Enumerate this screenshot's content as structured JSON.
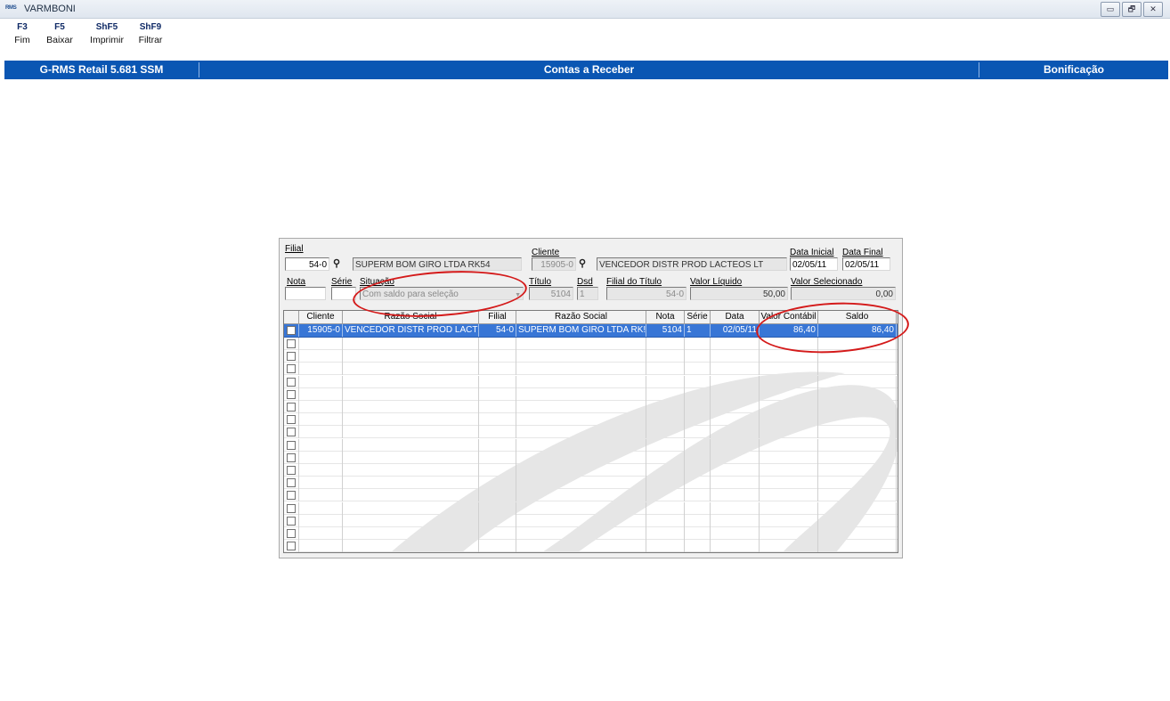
{
  "window": {
    "app_icon": "RMS",
    "title": "VARMBONI",
    "controls": [
      "▭",
      "🗗",
      "✕"
    ]
  },
  "fkeys": [
    {
      "key": "F3",
      "label": "Fim"
    },
    {
      "key": "F5",
      "label": "Baixar"
    },
    {
      "key": "ShF5",
      "label": "Imprimir"
    },
    {
      "key": "ShF9",
      "label": "Filtrar"
    }
  ],
  "bluebar": {
    "product": "G-RMS Retail 5.681 SSM",
    "module": "Contas a Receber",
    "screen": "Bonificação"
  },
  "form": {
    "filial_label": "Filial",
    "filial_value": "54-0",
    "filial_name": "SUPERM BOM GIRO LTDA RK54",
    "cliente_label": "Cliente",
    "cliente_value": "15905-0",
    "cliente_name": "VENCEDOR DISTR PROD LACTEOS LT",
    "data_inicial_label": "Data Inicial",
    "data_inicial_value": "02/05/11",
    "data_final_label": "Data Final",
    "data_final_value": "02/05/11",
    "nota_label": "Nota",
    "nota_value": "",
    "serie_label": "Série",
    "serie_value": "",
    "situacao_label": "Situação",
    "situacao_value": "Com saldo para seleção",
    "titulo_label": "Título",
    "titulo_value": "5104",
    "dsd_label": "Dsd",
    "dsd_value": "1",
    "filial_titulo_label": "Filial do Título",
    "filial_titulo_value": "54-0",
    "valor_liquido_label": "Valor Líquido",
    "valor_liquido_value": "50,00",
    "valor_selecionado_label": "Valor Selecionado",
    "valor_selecionado_value": "0,00"
  },
  "grid": {
    "headers": [
      "",
      "Cliente",
      "Razão Social",
      "Filial",
      "Razão Social",
      "Nota",
      "Série",
      "Data",
      "Valor Contábil",
      "Saldo"
    ],
    "rows": [
      [
        "",
        "15905-0",
        "VENCEDOR DISTR PROD LACT",
        "54-0",
        "SUPERM BOM GIRO LTDA RK!",
        "5104",
        "1",
        "02/05/11",
        "86,40",
        "86,40"
      ]
    ],
    "empty_rows": 17
  },
  "icons": {
    "lookup": "binoculars-icon",
    "checkbox": "checkbox-icon"
  },
  "colors": {
    "bluebar": "#0a56b3",
    "selected_row": "#3876d6",
    "annotation": "#d41a1a"
  }
}
